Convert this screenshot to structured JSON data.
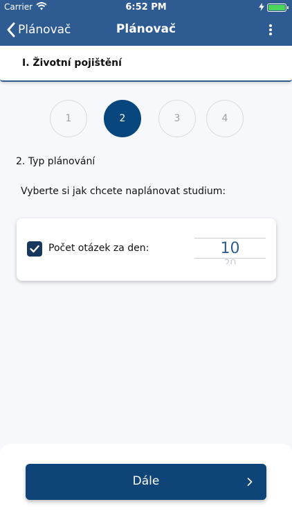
{
  "status_bar": {
    "carrier": "Carrier",
    "time": "6:52 PM"
  },
  "nav": {
    "back_label": "Plánovač",
    "title": "Plánovač"
  },
  "section": {
    "title": "I. Životní pojištění"
  },
  "steps": [
    {
      "label": "1",
      "active": false
    },
    {
      "label": "2",
      "active": true
    },
    {
      "label": "3",
      "active": false
    },
    {
      "label": "4",
      "active": false
    }
  ],
  "step_heading": "2. Typ plánování",
  "prompt": "Vyberte si jak chcete naplánovat studium:",
  "card": {
    "checkbox_checked": true,
    "label": "Počet otázek za den:",
    "value": "10",
    "next_value": "20"
  },
  "footer": {
    "next_label": "Dále"
  },
  "colors": {
    "nav_bar": "#2f5b93",
    "accent": "#08477e",
    "button": "#0f4478",
    "battery": "#49d65b"
  }
}
